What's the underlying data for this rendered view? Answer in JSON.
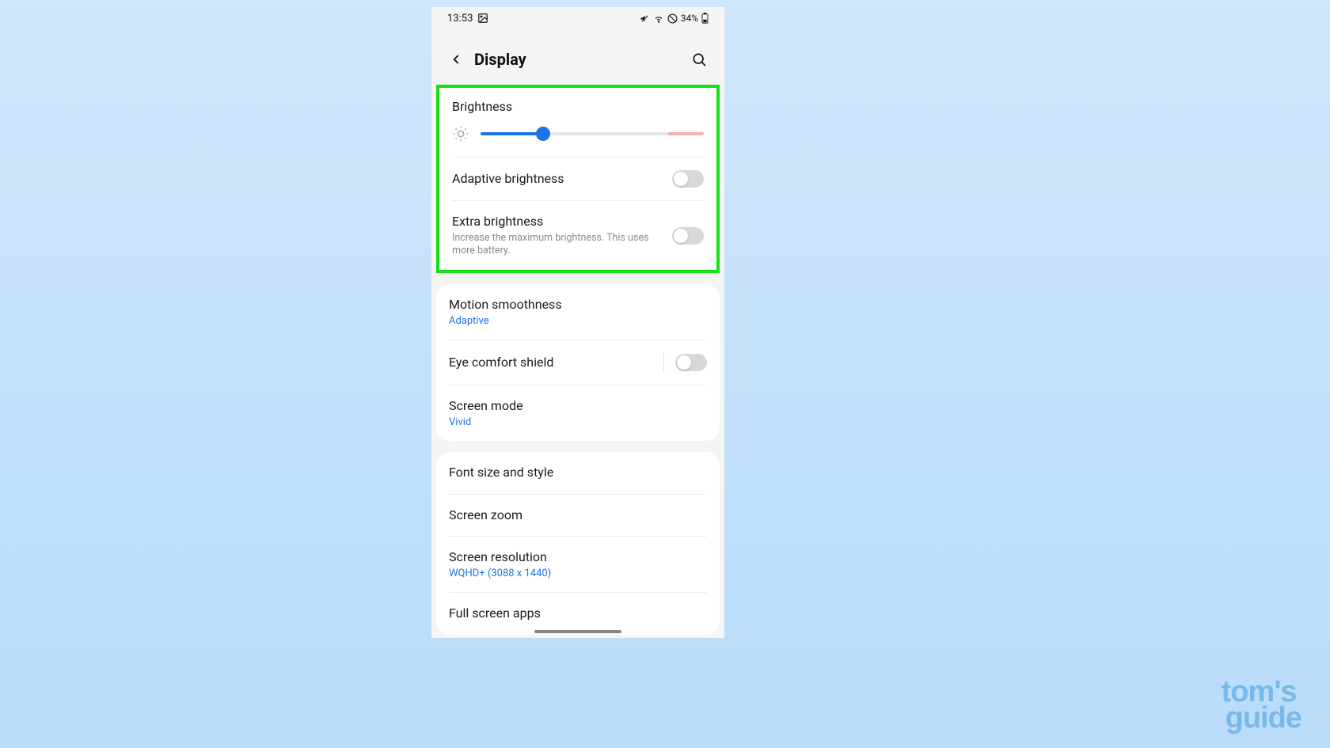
{
  "statusBar": {
    "time": "13:53",
    "battery": "34%"
  },
  "header": {
    "title": "Display"
  },
  "brightness": {
    "label": "Brightness",
    "percent": 28,
    "warnPercent": 16
  },
  "adaptive": {
    "label": "Adaptive brightness",
    "on": false
  },
  "extra": {
    "label": "Extra brightness",
    "sub": "Increase the maximum brightness. This uses more battery.",
    "on": false
  },
  "motion": {
    "label": "Motion smoothness",
    "value": "Adaptive"
  },
  "eyeComfort": {
    "label": "Eye comfort shield",
    "on": false
  },
  "screenMode": {
    "label": "Screen mode",
    "value": "Vivid"
  },
  "fontSize": {
    "label": "Font size and style"
  },
  "screenZoom": {
    "label": "Screen zoom"
  },
  "resolution": {
    "label": "Screen resolution",
    "value": "WQHD+ (3088 x 1440)"
  },
  "fullScreen": {
    "label": "Full screen apps"
  },
  "watermark": {
    "top": "tom's",
    "bottom": "guide"
  }
}
